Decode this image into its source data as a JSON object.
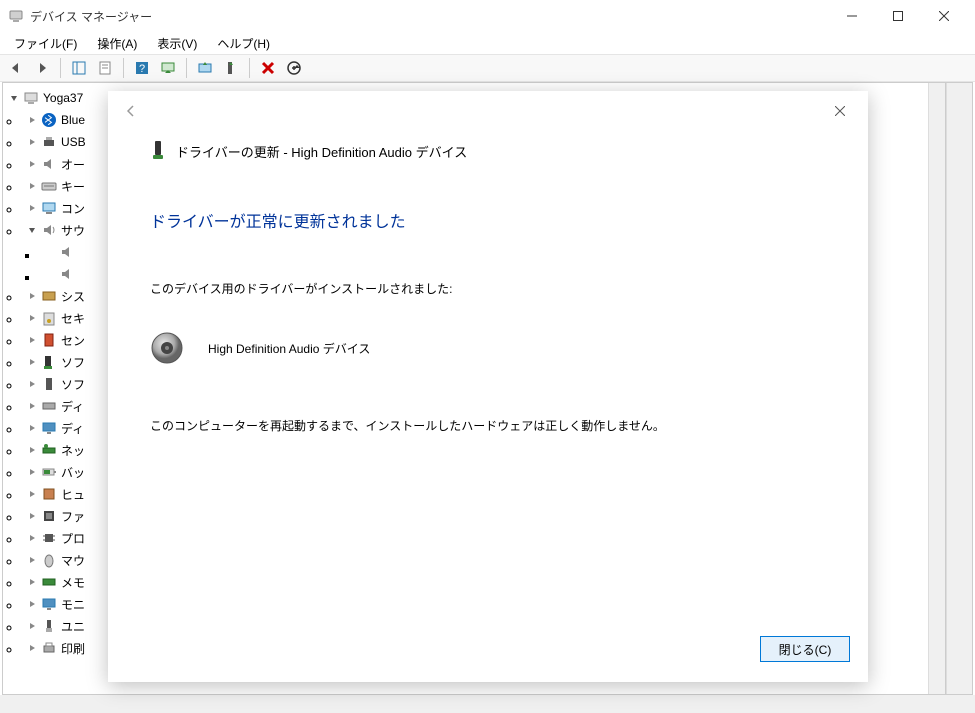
{
  "window": {
    "title": "デバイス マネージャー"
  },
  "menus": {
    "file": "ファイル(F)",
    "action": "操作(A)",
    "view": "表示(V)",
    "help": "ヘルプ(H)"
  },
  "tree": {
    "root": "Yoga37",
    "items": [
      {
        "label": "Blue",
        "icon": "bluetooth"
      },
      {
        "label": "USB",
        "icon": "usb"
      },
      {
        "label": "オー",
        "icon": "speaker"
      },
      {
        "label": "キー",
        "icon": "keyboard"
      },
      {
        "label": "コン",
        "icon": "computer"
      },
      {
        "label": "サウ",
        "icon": "sound",
        "expanded": true,
        "children": [
          {
            "label": "",
            "icon": "speaker-sub"
          },
          {
            "label": "",
            "icon": "speaker-sub"
          }
        ]
      },
      {
        "label": "シス",
        "icon": "system"
      },
      {
        "label": "セキ",
        "icon": "security"
      },
      {
        "label": "セン",
        "icon": "sensor"
      },
      {
        "label": "ソフ",
        "icon": "software"
      },
      {
        "label": "ソフ",
        "icon": "software2"
      },
      {
        "label": "ディ",
        "icon": "disk"
      },
      {
        "label": "ディ",
        "icon": "display"
      },
      {
        "label": "ネッ",
        "icon": "network"
      },
      {
        "label": "バッ",
        "icon": "battery"
      },
      {
        "label": "ヒュ",
        "icon": "hid"
      },
      {
        "label": "ファ",
        "icon": "firmware"
      },
      {
        "label": "プロ",
        "icon": "processor"
      },
      {
        "label": "マウ",
        "icon": "mouse"
      },
      {
        "label": "メモ",
        "icon": "memory"
      },
      {
        "label": "モニ",
        "icon": "monitor"
      },
      {
        "label": "ユニ",
        "icon": "usb-plug"
      },
      {
        "label": "印刷",
        "icon": "printer"
      }
    ]
  },
  "dialog": {
    "title": "ドライバーの更新 - High Definition Audio デバイス",
    "heading": "ドライバーが正常に更新されました",
    "installed_text": "このデバイス用のドライバーがインストールされました:",
    "device_name": "High Definition Audio デバイス",
    "restart_text": "このコンピューターを再起動するまで、インストールしたハードウェアは正しく動作しません。",
    "close_button": "閉じる(C)"
  }
}
